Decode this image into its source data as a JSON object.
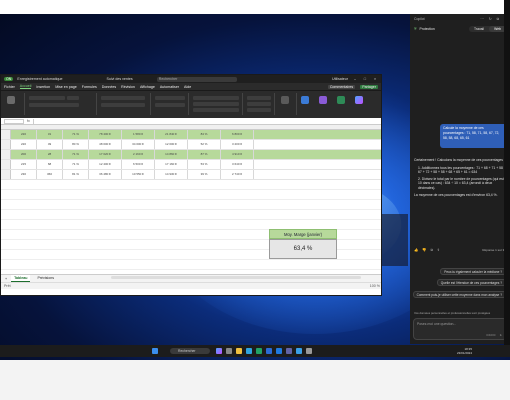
{
  "excel": {
    "autosave": "ON",
    "title": "Enregistrement automatique",
    "filename": "Suivi des ventes",
    "search_placeholder": "Rechercher",
    "user": "Utilisateur",
    "menu": [
      "Fichier",
      "Accueil",
      "Insertion",
      "Mise en page",
      "Formules",
      "Données",
      "Révision",
      "Affichage",
      "Automatiser",
      "Aide"
    ],
    "menu_active": "Accueil",
    "comments_btn": "Commentaires",
    "share_btn": "Partager",
    "rows": [
      [
        "220",
        "31",
        "71 %",
        "78 400 €",
        "1 580 €",
        "21 840 €",
        "84 %",
        "6 800 €"
      ],
      [
        "220",
        "49",
        "80 %",
        "48 000 €",
        "34 000 €",
        "12 000 €",
        "52 %",
        "3 200 €"
      ],
      [
        "200",
        "28",
        "71 %",
        "17 020 €",
        "2 160 €",
        "14 860 €",
        "87 %",
        "4 910 €"
      ],
      [
        "215",
        "68",
        "71 %",
        "12 400 €",
        "6 500 €",
        "17 160 €",
        "53 %",
        "3 640 €"
      ],
      [
        "230",
        "360",
        "81 %",
        "36 480 €",
        "10 550 €",
        "14 930 €",
        "39 %",
        "2 740 €"
      ]
    ],
    "kpi_label": "Moy. Marge (janvier)",
    "kpi_value": "63,4 %",
    "sheet_tabs": [
      "Tableau",
      "Prévisions"
    ],
    "sheet_active": "Tableau",
    "status_left": "Prêt",
    "zoom": "100 %"
  },
  "copilot": {
    "title": "Copilot",
    "protected": "Protection",
    "mode_options": [
      "Travail",
      "Web"
    ],
    "mode_active": "Web",
    "user_message": "Calcule la moyenne de ces pourcentages : 71, 58, 71, 58, 67, 72, 58, 58, 68, 65, 61",
    "answer_intro": "Certainement ! Calculons la moyenne de ces pourcentages :",
    "answer_steps": [
      "1. Additionnez tous les pourcentages : 71 + 68 + 71 + 58 + 67 + 72 + 58 + 58 + 68 + 65 + 61 = 634",
      "2. Divisez le total par le nombre de pourcentages (qui est 10 dans ce cas) : 634 ÷ 10 = 63,4 (arrondi à deux décimales)."
    ],
    "answer_outro": "La moyenne de ces pourcentages est d'environ 63,4 %.",
    "reply_counter": "Réponse 1 sur 30",
    "suggestions": [
      "Peux-tu également calculer la médiane ?",
      "Quelle est l'étendue de ces pourcentages ?",
      "Comment puis-je utiliser cette moyenne dans mon analyse ?"
    ],
    "privacy_note": "Vos données personnelles et professionnelles sont protégées",
    "input_placeholder": "Posez-moi une question...",
    "char_count": "0/4000"
  },
  "taskbar": {
    "search_label": "Rechercher",
    "time": "18:35",
    "date": "23/01/2024"
  },
  "colors": {
    "excel_green": "#b7d99b",
    "copilot_bubble": "#2f5fb8"
  }
}
